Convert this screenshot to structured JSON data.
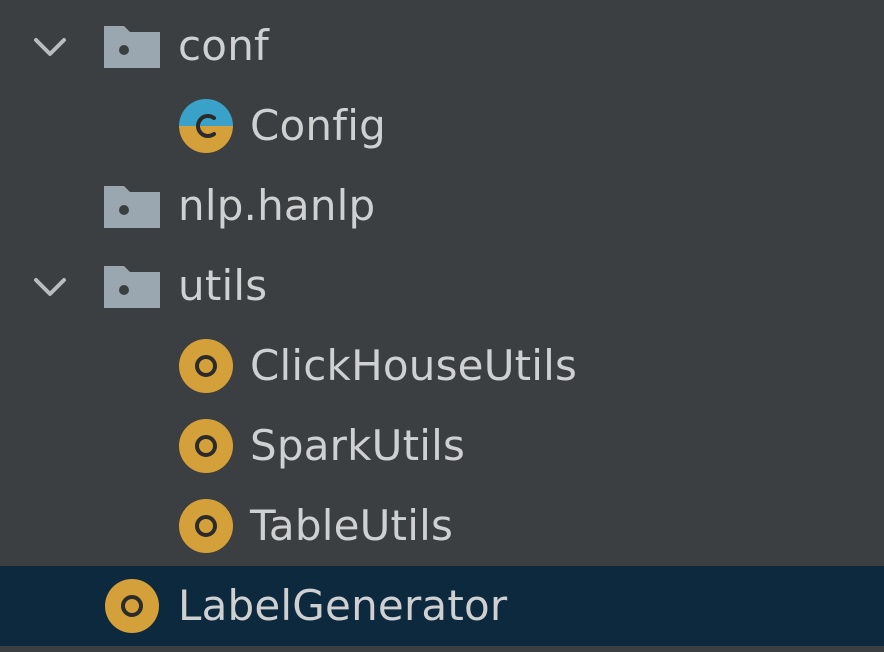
{
  "tree": {
    "items": [
      {
        "label": "conf",
        "kind": "package",
        "icon": "package-folder-icon",
        "expanded": true
      },
      {
        "label": "Config",
        "kind": "class",
        "icon": "config-class-icon"
      },
      {
        "label": "nlp.hanlp",
        "kind": "package",
        "icon": "package-folder-icon"
      },
      {
        "label": "utils",
        "kind": "package",
        "icon": "package-folder-icon",
        "expanded": true
      },
      {
        "label": "ClickHouseUtils",
        "kind": "object",
        "icon": "scala-object-icon"
      },
      {
        "label": "SparkUtils",
        "kind": "object",
        "icon": "scala-object-icon"
      },
      {
        "label": "TableUtils",
        "kind": "object",
        "icon": "scala-object-icon"
      },
      {
        "label": "LabelGenerator",
        "kind": "object",
        "icon": "scala-object-icon",
        "selected": true
      }
    ]
  },
  "colors": {
    "background": "#3c3f41",
    "selection": "#0d293e",
    "text": "#cfd0d2",
    "folder": "#9aa7b0",
    "object_orange": "#d4a03a",
    "class_blue": "#3aa2c8"
  }
}
